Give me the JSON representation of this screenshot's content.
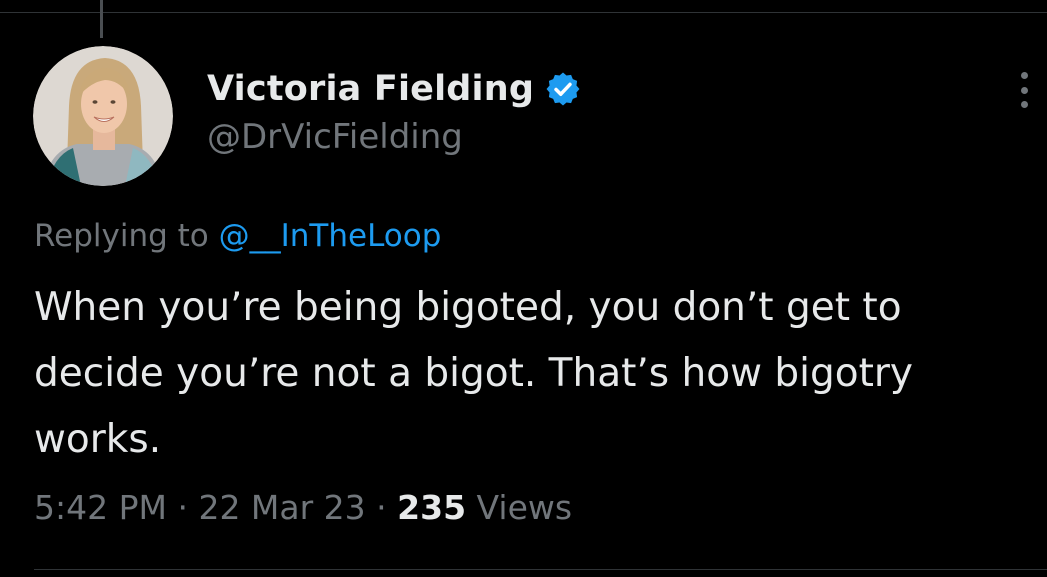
{
  "author": {
    "display_name": "Victoria Fielding",
    "handle": "@DrVicFielding",
    "verified": true,
    "verified_color": "#1d9bf0"
  },
  "reply": {
    "prefix": "Replying to ",
    "target": "@__InTheLoop"
  },
  "tweet": {
    "text": "When you’re being bigoted, you don’t get to decide you’re not a bigot. That’s how bigotry works."
  },
  "meta": {
    "time": "5:42 PM",
    "separator": " · ",
    "date": "22 Mar 23",
    "views_count": "235",
    "views_label": " Views"
  },
  "icons": {
    "avatar": "avatar-photo",
    "verified": "verified-badge-icon",
    "more": "more-options-icon"
  },
  "colors": {
    "background": "#000000",
    "primary_text": "#e7e9ea",
    "secondary_text": "#71767b",
    "link": "#1d9bf0"
  }
}
